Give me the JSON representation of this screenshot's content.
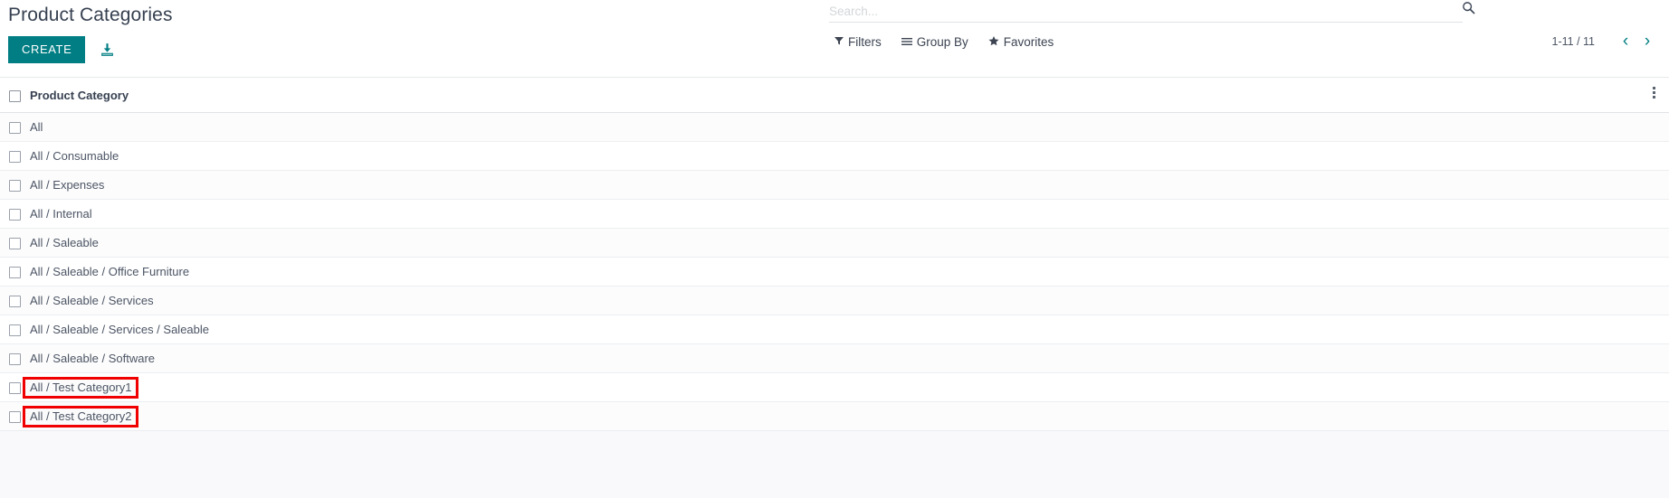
{
  "page": {
    "title": "Product Categories",
    "background_color": "#f9f9fb",
    "accent_color": "#017e84",
    "highlight_color": "#f00000"
  },
  "toolbar": {
    "create_label": "CREATE",
    "import_icon": "download-icon"
  },
  "search": {
    "placeholder": "Search...",
    "value": "",
    "search_icon": "search-icon",
    "menus": [
      {
        "label": "Filters",
        "icon": "filter-icon",
        "glyph": "▼"
      },
      {
        "label": "Group By",
        "icon": "group-by-icon",
        "glyph": "≡"
      },
      {
        "label": "Favorites",
        "icon": "star-icon",
        "glyph": "★"
      }
    ]
  },
  "pager": {
    "range": "1-11 / 11",
    "prev_icon": "chevron-left-icon",
    "prev_glyph": "‹",
    "next_icon": "chevron-right-icon",
    "next_glyph": "›"
  },
  "list": {
    "columns": [
      "Product Category"
    ],
    "options_icon": "kebab-menu-icon",
    "rows": [
      {
        "name": "All",
        "highlighted": false
      },
      {
        "name": "All / Consumable",
        "highlighted": false
      },
      {
        "name": "All / Expenses",
        "highlighted": false
      },
      {
        "name": "All / Internal",
        "highlighted": false
      },
      {
        "name": "All / Saleable",
        "highlighted": false
      },
      {
        "name": "All / Saleable / Office Furniture",
        "highlighted": false
      },
      {
        "name": "All / Saleable / Services",
        "highlighted": false
      },
      {
        "name": "All / Saleable / Services / Saleable",
        "highlighted": false
      },
      {
        "name": "All / Saleable / Software",
        "highlighted": false
      },
      {
        "name": "All / Test Category1",
        "highlighted": true
      },
      {
        "name": "All / Test Category2",
        "highlighted": true
      }
    ]
  }
}
